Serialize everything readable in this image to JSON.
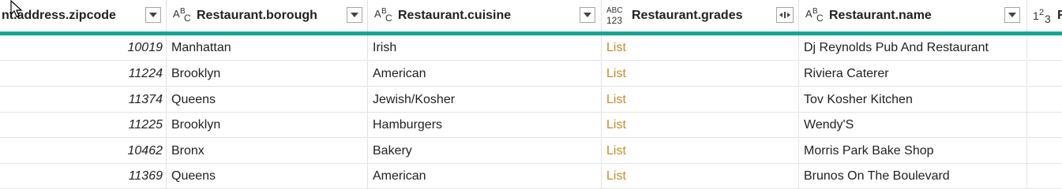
{
  "columns": [
    {
      "name": "nt.address.zipcode",
      "type_icon": "none",
      "filter_icon": "dropdown-icon"
    },
    {
      "name": "Restaurant.borough",
      "type_icon": "text-type-icon",
      "filter_icon": "dropdown-icon"
    },
    {
      "name": "Restaurant.cuisine",
      "type_icon": "text-type-icon",
      "filter_icon": "dropdown-icon"
    },
    {
      "name": "Restaurant.grades",
      "type_icon": "any-type-icon",
      "filter_icon": "expand-icon"
    },
    {
      "name": "Restaurant.name",
      "type_icon": "text-type-icon",
      "filter_icon": "dropdown-icon"
    },
    {
      "name": "R",
      "type_icon": "number-type-icon",
      "filter_icon": ""
    }
  ],
  "type_labels": {
    "text_a": "A",
    "text_b": "B",
    "text_c": "C",
    "any_top": "ABC",
    "any_bottom": "123",
    "num_1": "1",
    "num_2": "2",
    "num_3": "3"
  },
  "rows": [
    {
      "zipcode": "10019",
      "borough": "Manhattan",
      "cuisine": "Irish",
      "grades": "List",
      "name": "Dj Reynolds Pub And Restaurant"
    },
    {
      "zipcode": "11224",
      "borough": "Brooklyn",
      "cuisine": "American",
      "grades": "List",
      "name": "Riviera Caterer"
    },
    {
      "zipcode": "11374",
      "borough": "Queens",
      "cuisine": "Jewish/Kosher",
      "grades": "List",
      "name": "Tov Kosher Kitchen"
    },
    {
      "zipcode": "11225",
      "borough": "Brooklyn",
      "cuisine": "Hamburgers",
      "grades": "List",
      "name": "Wendy'S"
    },
    {
      "zipcode": "10462",
      "borough": "Bronx",
      "cuisine": "Bakery",
      "grades": "List",
      "name": "Morris Park Bake Shop"
    },
    {
      "zipcode": "11369",
      "borough": "Queens",
      "cuisine": "American",
      "grades": "List",
      "name": "Brunos On The Boulevard"
    }
  ],
  "colors": {
    "accent": "#19a493",
    "list_link": "#c58d2b",
    "grid_line": "#e3e3e3"
  }
}
